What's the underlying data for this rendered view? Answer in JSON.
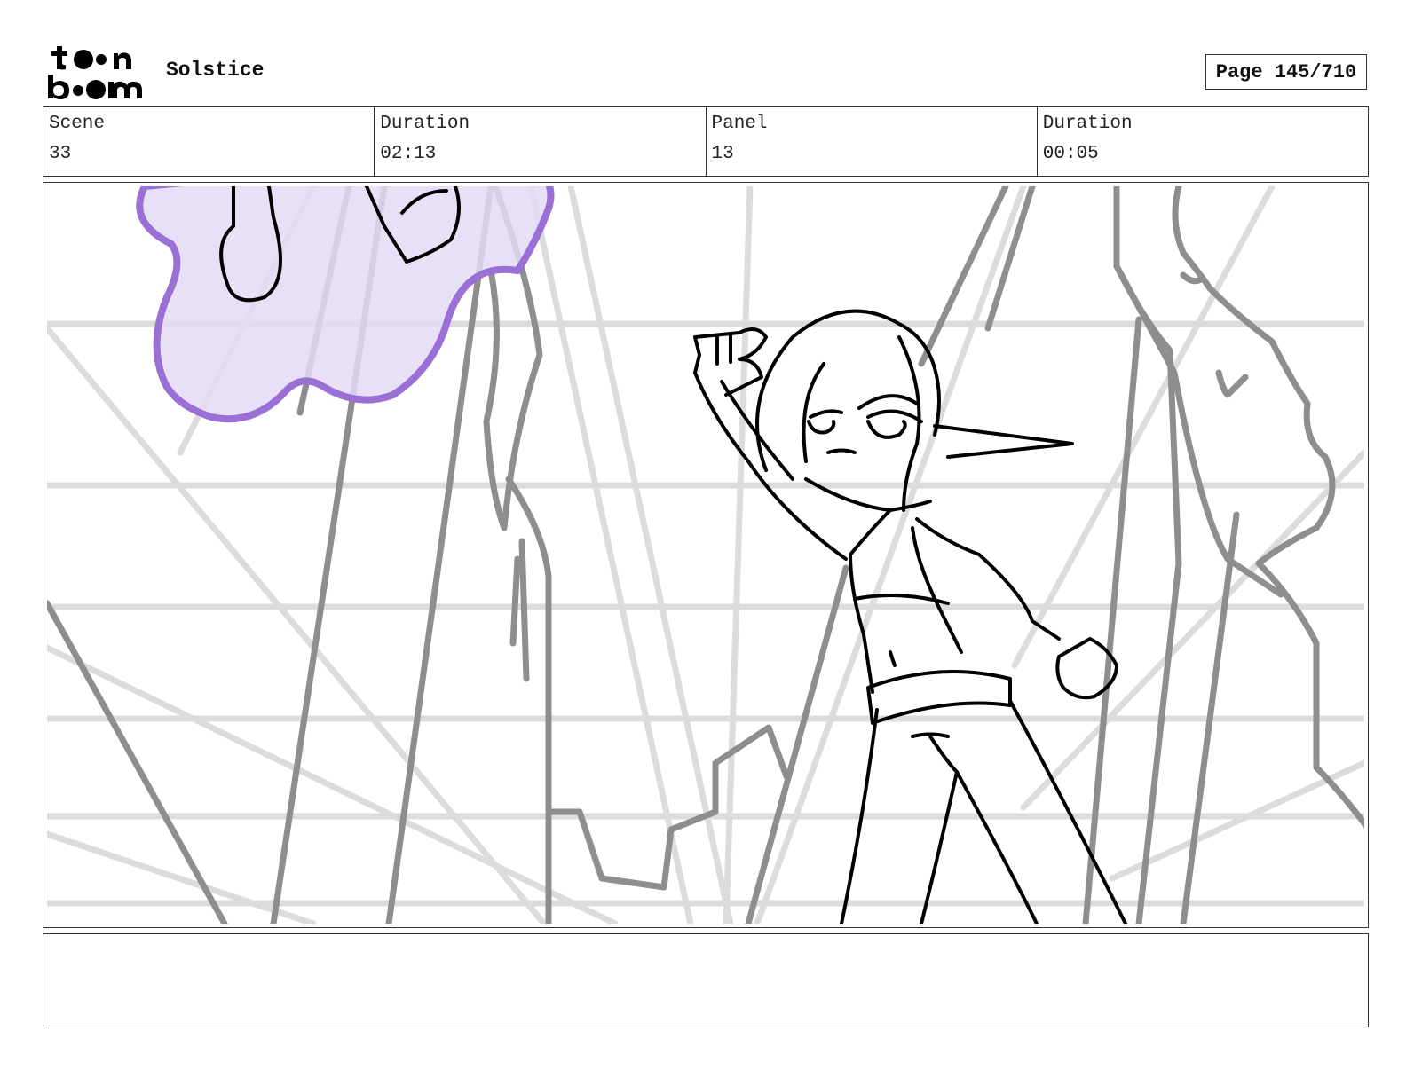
{
  "header": {
    "logo_text_top": "toon",
    "logo_text_bottom": "boom",
    "project_title": "Solstice",
    "page_indicator": "Page 145/710"
  },
  "info": {
    "scene_label": "Scene",
    "scene_value": "33",
    "scene_duration_label": "Duration",
    "scene_duration_value": "02:13",
    "panel_label": "Panel",
    "panel_value": "13",
    "panel_duration_label": "Duration",
    "panel_duration_value": "00:05"
  },
  "panel": {
    "accent_color": "#9a6fd6",
    "accent_fill": "#e4daf5",
    "grid_color": "#dcdcdc",
    "background_line_color": "#8e8e8e",
    "ink_color": "#000000"
  },
  "notes": {
    "text": ""
  }
}
